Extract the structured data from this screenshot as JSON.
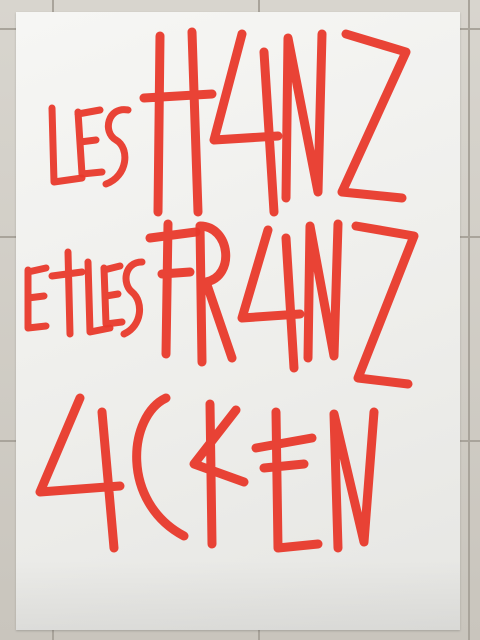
{
  "poster": {
    "line1": "LES HANZ",
    "line2": "ET LES FRANZ",
    "line3": "ACKEN",
    "ink_color": "#e8392b",
    "paper_color": "#f2f2ef"
  }
}
